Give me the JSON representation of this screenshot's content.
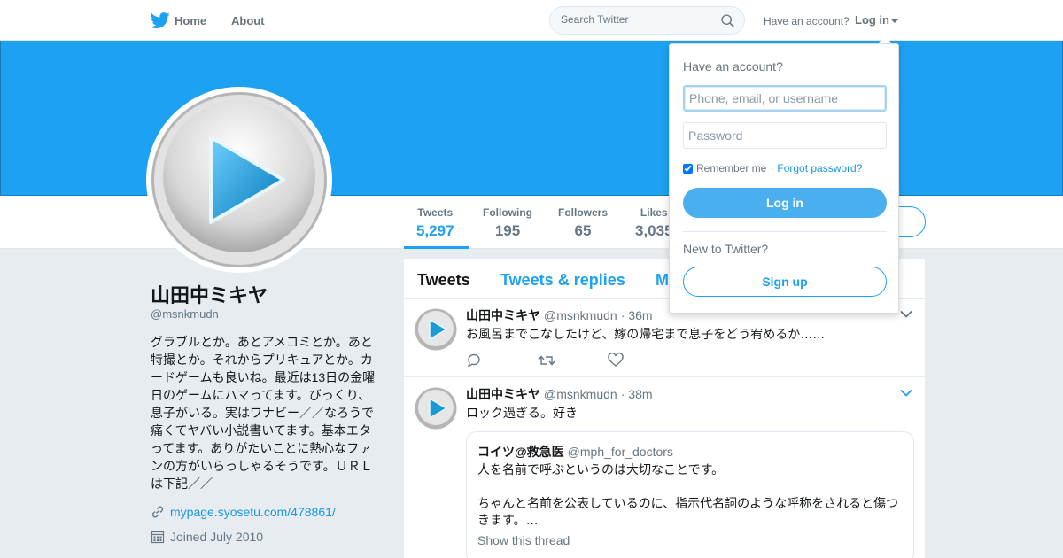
{
  "topbar": {
    "home_label": "Home",
    "about_label": "About",
    "search_placeholder": "Search Twitter",
    "have_account": "Have an account?",
    "login_label": "Log in"
  },
  "profile": {
    "name": "山田中ミキヤ",
    "handle": "@msnkmudn",
    "bio": "グラブルとか。あとアメコミとか。あと\n特撮とか。それからプリキュアとか。カ\nードゲームも良いね。最近は13日の金曜\n日のゲームにハマってます。びっくり、\n息子がいる。実はワナビー／／なろうで\n痛くてヤバい小説書いてます。基本エタ\nってます。ありがたいことに熱心なファ\nンの方がいらっしゃるそうです。ＵＲＬ\nは下記／／",
    "link": "mypage.syosetu.com/478861/",
    "joined": "Joined July 2010"
  },
  "stats": [
    {
      "label": "Tweets",
      "value": "5,297"
    },
    {
      "label": "Following",
      "value": "195"
    },
    {
      "label": "Followers",
      "value": "65"
    },
    {
      "label": "Likes",
      "value": "3,035"
    }
  ],
  "timeline": {
    "tabs": [
      "Tweets",
      "Tweets & replies",
      "Media"
    ],
    "tweets": [
      {
        "name": "山田中ミキヤ",
        "handle": "@msnkmudn",
        "time": "36m",
        "text": "お風呂までこなしたけど、嫁の帰宅まで息子をどう宥めるか……"
      },
      {
        "name": "山田中ミキヤ",
        "handle": "@msnkmudn",
        "time": "38m",
        "text": "ロック過ぎる。好き",
        "quote": {
          "name": "コイツ@救急医",
          "handle": "@mph_for_doctors",
          "text": "人を名前で呼ぶというのは大切なことです。\n\nちゃんと名前を公表しているのに、指示代名詞のような呼称をされると傷つきます。…",
          "thread_label": "Show this thread"
        }
      }
    ]
  },
  "login_dropdown": {
    "title": "Have an account?",
    "username_placeholder": "Phone, email, or username",
    "password_placeholder": "Password",
    "remember_label": "Remember me",
    "separator": "·",
    "forgot_label": "Forgot password?",
    "login_button": "Log in",
    "new_label": "New to Twitter?",
    "signup_button": "Sign up"
  },
  "colors": {
    "accent": "#1da1f2",
    "banner": "#1da1f2",
    "page_bg": "#e6ecf0"
  },
  "icons": {
    "brand": "twitter-bird-icon",
    "search": "search-icon",
    "link": "link-icon",
    "calendar": "calendar-icon",
    "reply": "reply-icon",
    "retweet": "retweet-icon",
    "like": "heart-icon",
    "more": "chevron-down-icon",
    "avatar": "play-button-icon"
  }
}
